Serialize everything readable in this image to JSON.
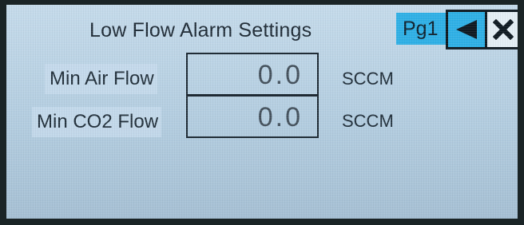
{
  "screen": {
    "title": "Low Flow Alarm Settings",
    "page_indicator": "Pg1"
  },
  "nav": {
    "back_icon": "left-triangle-icon",
    "close_icon": "close-x-icon"
  },
  "fields": [
    {
      "label": "Min Air Flow",
      "value": "0.0",
      "unit": "SCCM"
    },
    {
      "label": "Min CO2 Flow",
      "value": "0.0",
      "unit": "SCCM"
    }
  ],
  "colors": {
    "screen_bg": "#b6cfe2",
    "accent": "#2fb0e6",
    "bezel": "#1a2426",
    "text": "#22303b"
  }
}
